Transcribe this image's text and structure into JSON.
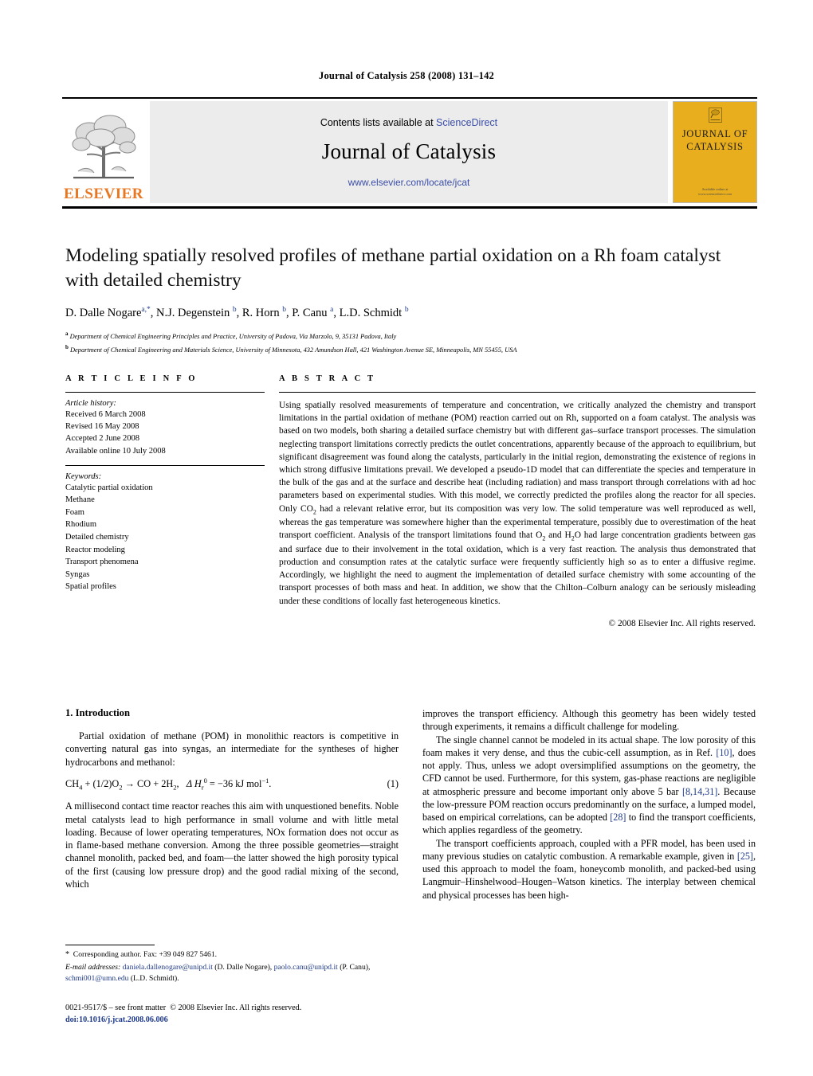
{
  "running_head": "Journal of Catalysis 258 (2008) 131–142",
  "masthead": {
    "publisher_wordmark": "ELSEVIER",
    "contents_prefix": "Contents lists available at ",
    "contents_link": "ScienceDirect",
    "journal_title": "Journal of Catalysis",
    "journal_url": "www.elsevier.com/locate/jcat",
    "cover_title_line1": "JOURNAL OF",
    "cover_title_line2": "CATALYSIS",
    "cover_footer": "Available online at\nwww.sciencedirect.com",
    "cover_color": "#E8AE1E",
    "link_color": "#3b4ea8",
    "elsevier_orange": "#E87722"
  },
  "article": {
    "title": "Modeling spatially resolved profiles of methane partial oxidation on a Rh foam catalyst with detailed chemistry",
    "authors_html": "D. Dalle Nogare<sup>a,</sup><sup>*</sup>, N.J. Degenstein <sup>b</sup>, R. Horn <sup>b</sup>, P. Canu <sup>a</sup>, L.D. Schmidt <sup>b</sup>",
    "affiliations": [
      {
        "marker": "a",
        "text": "Department of Chemical Engineering Principles and Practice, University of Padova, Via Marzolo, 9, 35131 Padova, Italy"
      },
      {
        "marker": "b",
        "text": "Department of Chemical Engineering and Materials Science, University of Minnesota, 432 Amundson Hall, 421 Washington Avenue SE, Minneapolis, MN 55455, USA"
      }
    ]
  },
  "info": {
    "heading": "A R T I C L E   I N F O",
    "history_label": "Article history:",
    "history": [
      "Received 6 March 2008",
      "Revised 16 May 2008",
      "Accepted 2 June 2008",
      "Available online 10 July 2008"
    ],
    "keywords_label": "Keywords:",
    "keywords": [
      "Catalytic partial oxidation",
      "Methane",
      "Foam",
      "Rhodium",
      "Detailed chemistry",
      "Reactor modeling",
      "Transport phenomena",
      "Syngas",
      "Spatial profiles"
    ]
  },
  "abstract": {
    "heading": "A B S T R A C T",
    "body_html": "Using spatially resolved measurements of temperature and concentration, we critically analyzed the chemistry and transport limitations in the partial oxidation of methane (POM) reaction carried out on Rh, supported on a foam catalyst. The analysis was based on two models, both sharing a detailed surface chemistry but with different gas–surface transport processes. The simulation neglecting transport limitations correctly predicts the outlet concentrations, apparently because of the approach to equilibrium, but significant disagreement was found along the catalysts, particularly in the initial region, demonstrating the existence of regions in which strong diffusive limitations prevail. We developed a pseudo-1D model that can differentiate the species and temperature in the bulk of the gas and at the surface and describe heat (including radiation) and mass transport through correlations with ad hoc parameters based on experimental studies. With this model, we correctly predicted the profiles along the reactor for all species. Only CO<sub>2</sub> had a relevant relative error, but its composition was very low. The solid temperature was well reproduced as well, whereas the gas temperature was somewhere higher than the experimental temperature, possibly due to overestimation of the heat transport coefficient. Analysis of the transport limitations found that O<sub>2</sub> and H<sub>2</sub>O had large concentration gradients between gas and surface due to their involvement in the total oxidation, which is a very fast reaction. The analysis thus demonstrated that production and consumption rates at the catalytic surface were frequently sufficiently high so as to enter a diffusive regime. Accordingly, we highlight the need to augment the implementation of detailed surface chemistry with some accounting of the transport processes of both mass and heat. In addition, we show that the Chilton–Colburn analogy can be seriously misleading under these conditions of locally fast heterogeneous kinetics.",
    "copyright": "© 2008 Elsevier Inc. All rights reserved."
  },
  "body": {
    "section_number_title": "1. Introduction",
    "left_para_1": "Partial oxidation of methane (POM) in monolithic reactors is competitive in converting natural gas into syngas, an intermediate for the syntheses of higher hydrocarbons and methanol:",
    "equation_1_html": "CH<sub>4</sub> + (1/2)O<sub>2</sub> → CO + 2H<sub>2</sub>,&nbsp;&nbsp; <i>Δ H</i><sub>r</sub><sup class=\"inl\">0</sup> = −36 kJ mol<sup class=\"inl\">−1</sup>.",
    "equation_1_number": "(1)",
    "left_para_2": "A millisecond contact time reactor reaches this aim with unquestioned benefits. Noble metal catalysts lead to high performance in small volume and with little metal loading. Because of lower operating temperatures, NOx formation does not occur as in flame-based methane conversion. Among the three possible geometries—straight channel monolith, packed bed, and foam—the latter showed the high porosity typical of the first (causing low pressure drop) and the good radial mixing of the second, which",
    "right_para_1": "improves the transport efficiency. Although this geometry has been widely tested through experiments, it remains a difficult challenge for modeling.",
    "right_para_2_html": "The single channel cannot be modeled in its actual shape. The low porosity of this foam makes it very dense, and thus the cubic-cell assumption, as in Ref. <span class=\"ref\">[10]</span>, does not apply. Thus, unless we adopt oversimplified assumptions on the geometry, the CFD cannot be used. Furthermore, for this system, gas-phase reactions are negligible at atmospheric pressure and become important only above 5 bar <span class=\"ref\">[8,14,31]</span>. Because the low-pressure POM reaction occurs predominantly on the surface, a lumped model, based on empirical correlations, can be adopted <span class=\"ref\">[28]</span> to find the transport coefficients, which applies regardless of the geometry.",
    "right_para_3_html": "The transport coefficients approach, coupled with a PFR model, has been used in many previous studies on catalytic combustion. A remarkable example, given in <span class=\"ref\">[25]</span>, used this approach to model the foam, honeycomb monolith, and packed-bed using Langmuir–Hinshelwood–Hougen–Watson kinetics. The interplay between chemical and physical processes has been high-"
  },
  "footnotes": {
    "corresponding_html": "<span class=\"star\">*</span>&nbsp;&nbsp;Corresponding author. Fax: +39 049 827 5461.",
    "emails_html": "<span class=\"fn-em\">E-mail addresses:</span> <span class=\"mail\">daniela.dallenogare@unipd.it</span> (D. Dalle Nogare), <span class=\"mail\">paolo.canu@unipd.it</span> (P. Canu), <span class=\"mail\">schmi001@umn.edu</span> (L.D. Schmidt)."
  },
  "footer": {
    "issn_html": "0021-9517/$ – see front matter&nbsp; © 2008 Elsevier Inc. All rights reserved.",
    "doi_text": "doi:10.1016/j.jcat.2008.06.006"
  }
}
